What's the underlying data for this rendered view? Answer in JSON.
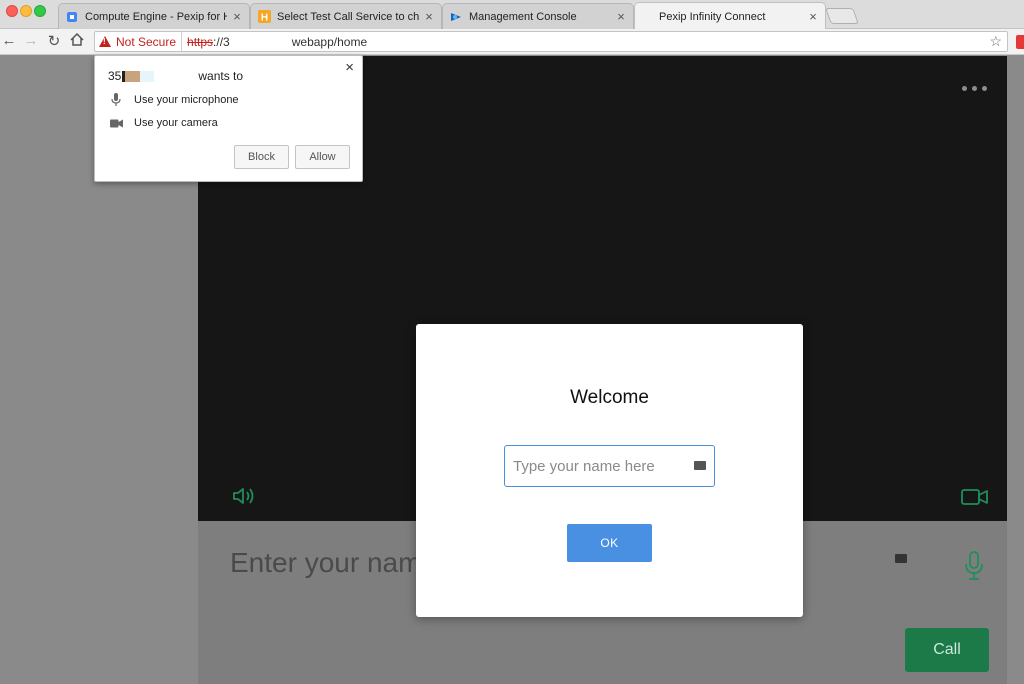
{
  "browser": {
    "tabs": [
      {
        "title": "Compute Engine - Pexip for He",
        "icon": "compute-engine-icon"
      },
      {
        "title": "Select Test Call Service to cha",
        "icon": "hubspot-h-icon"
      },
      {
        "title": "Management Console",
        "icon": "pexip-console-icon"
      },
      {
        "title": "Pexip Infinity Connect",
        "icon": "none"
      }
    ],
    "close_glyph": "×",
    "security_label": "Not Secure",
    "url": {
      "scheme": "https",
      "after_scheme": "://3",
      "path": "webapp/home"
    }
  },
  "permission_popup": {
    "origin_prefix": "35",
    "wants_to": "wants to",
    "items": [
      {
        "label": "Use your microphone",
        "icon": "microphone-icon"
      },
      {
        "label": "Use your camera",
        "icon": "camera-icon"
      }
    ],
    "block_label": "Block",
    "allow_label": "Allow",
    "close_glyph": "×"
  },
  "background_page": {
    "name_input_text": "Enter your nam",
    "call_label": "Call"
  },
  "welcome_dialog": {
    "title": "Welcome",
    "name_placeholder": "Type your name here",
    "ok_label": "OK"
  },
  "colors": {
    "accent_blue": "#4a90e2",
    "call_green": "#1b7a48",
    "icon_green": "#1f8f5a",
    "warning_red": "#c5221f"
  }
}
